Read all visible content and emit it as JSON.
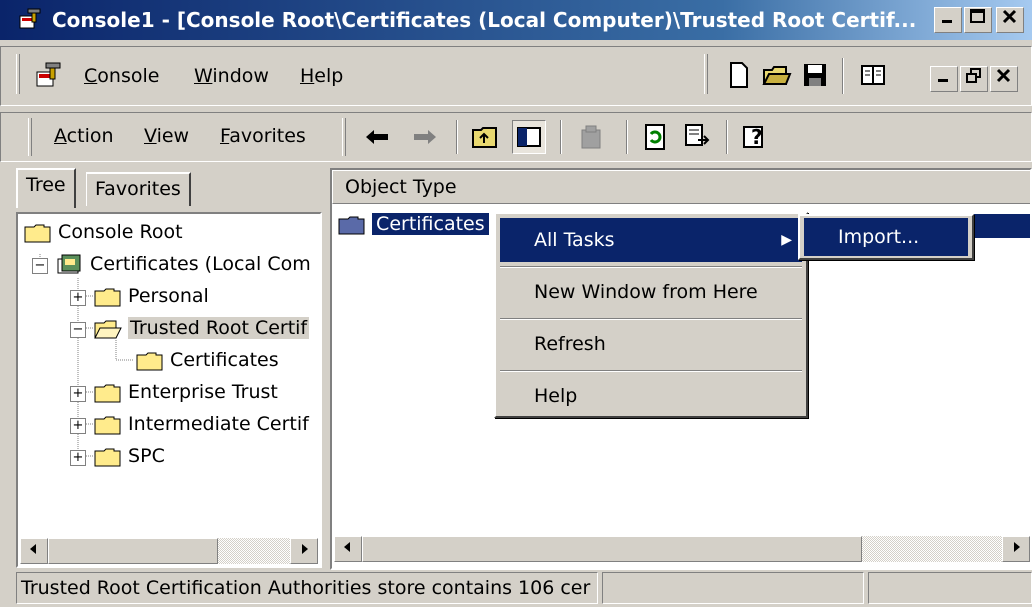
{
  "window": {
    "title": "Console1 - [Console Root\\Certificates (Local Computer)\\Trusted Root Certif...",
    "icon": "mmc-console-icon"
  },
  "menubar": {
    "items": [
      "Console",
      "Window",
      "Help"
    ],
    "accel": [
      "C",
      "W",
      "H"
    ]
  },
  "actionbar": {
    "items": [
      "Action",
      "View",
      "Favorites"
    ]
  },
  "tabs": [
    "Tree",
    "Favorites"
  ],
  "tree": {
    "items": [
      {
        "label": "Console Root"
      },
      {
        "label": "Certificates (Local Com"
      },
      {
        "label": "Personal"
      },
      {
        "label": "Trusted Root Certif"
      },
      {
        "label": "Certificates"
      },
      {
        "label": "Enterprise Trust"
      },
      {
        "label": "Intermediate Certif"
      },
      {
        "label": "SPC"
      }
    ]
  },
  "list": {
    "column_header": "Object Type",
    "rows": [
      "Certificates"
    ]
  },
  "context_menu": {
    "items": [
      "All Tasks",
      "New Window from Here",
      "Refresh",
      "Help"
    ]
  },
  "submenu": {
    "items": [
      "Import..."
    ]
  },
  "statusbar": {
    "text": "Trusted Root Certification Authorities store contains 106 cer"
  },
  "colors": {
    "highlight": "#0a246a",
    "face": "#d4d0c8",
    "title_start": "#0a246a"
  }
}
